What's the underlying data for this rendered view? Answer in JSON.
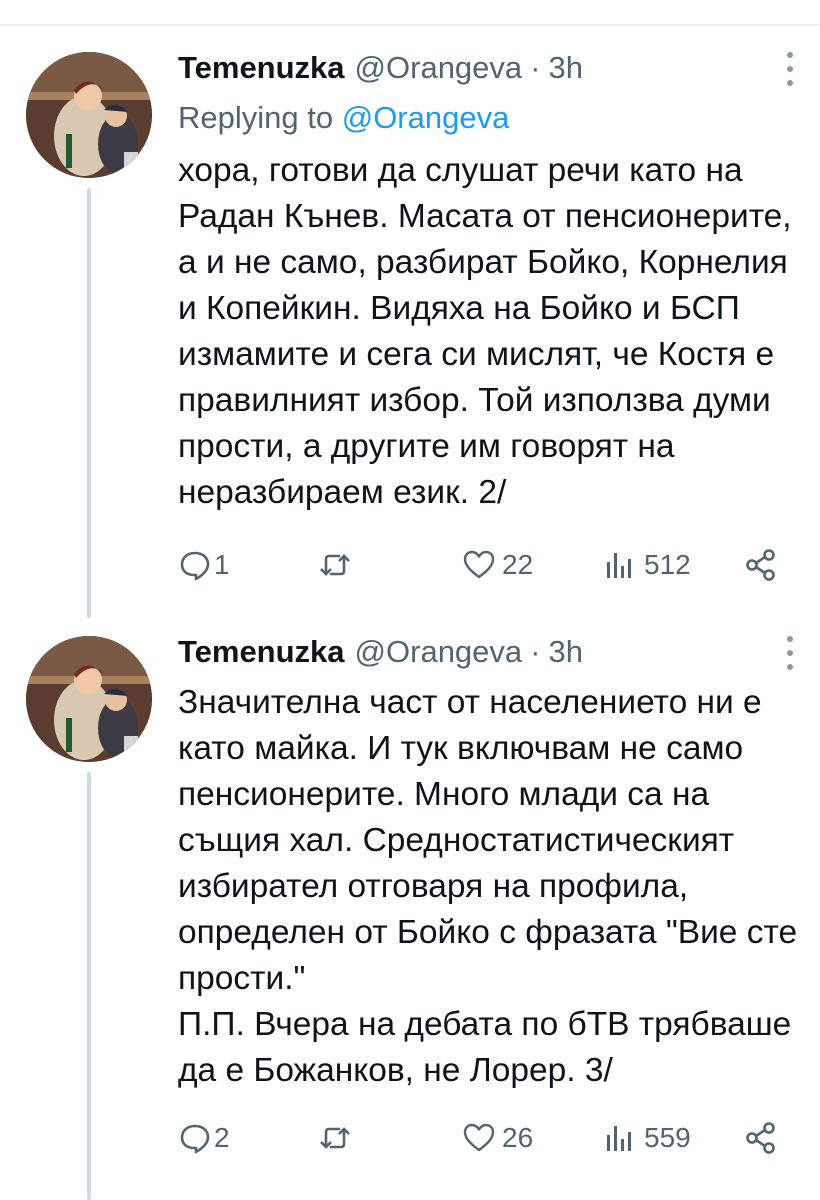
{
  "tweets": [
    {
      "author_name": "Temenuzka",
      "author_handle": "@Orangeva",
      "separator": "·",
      "time": "3h",
      "reply_prefix": "Replying to",
      "reply_handle": "@Orangeva",
      "text": "хора, готови да слушат речи като на Радан Кънев. Масата от пенсионерите, а и не само, разбират Бойко, Корнелия и Копейкин. Видяха на Бойко и БСП измамите и сега си мислят, че Костя е правилният избор. Той използва думи прости, а другите им говорят на неразбираем език. 2/",
      "replies": "1",
      "retweets": "",
      "likes": "22",
      "views": "512",
      "icons": {
        "reply": "reply-icon",
        "retweet": "retweet-icon",
        "like": "heart-icon",
        "views": "views-icon",
        "share": "share-icon",
        "more": "more-icon"
      }
    },
    {
      "author_name": "Temenuzka",
      "author_handle": "@Orangeva",
      "separator": "·",
      "time": "3h",
      "text": "Значителна част от населението ни е като майка. И тук включвам не само пенсионерите. Много млади са на същия хал. Средностатистическият избирател отговаря на профила, определен от Бойко с фразата \"Вие сте прости.\"\nП.П. Вчера на дебата по бТВ трябваше да е Божанков, не Лорер. 3/",
      "replies": "2",
      "retweets": "",
      "likes": "26",
      "views": "559",
      "icons": {
        "reply": "reply-icon",
        "retweet": "retweet-icon",
        "like": "heart-icon",
        "views": "views-icon",
        "share": "share-icon",
        "more": "more-icon"
      }
    }
  ],
  "colors": {
    "accent": "#1d9bf0",
    "text": "#0f1419",
    "secondary": "#536471",
    "thread_line": "#cfd9de"
  }
}
